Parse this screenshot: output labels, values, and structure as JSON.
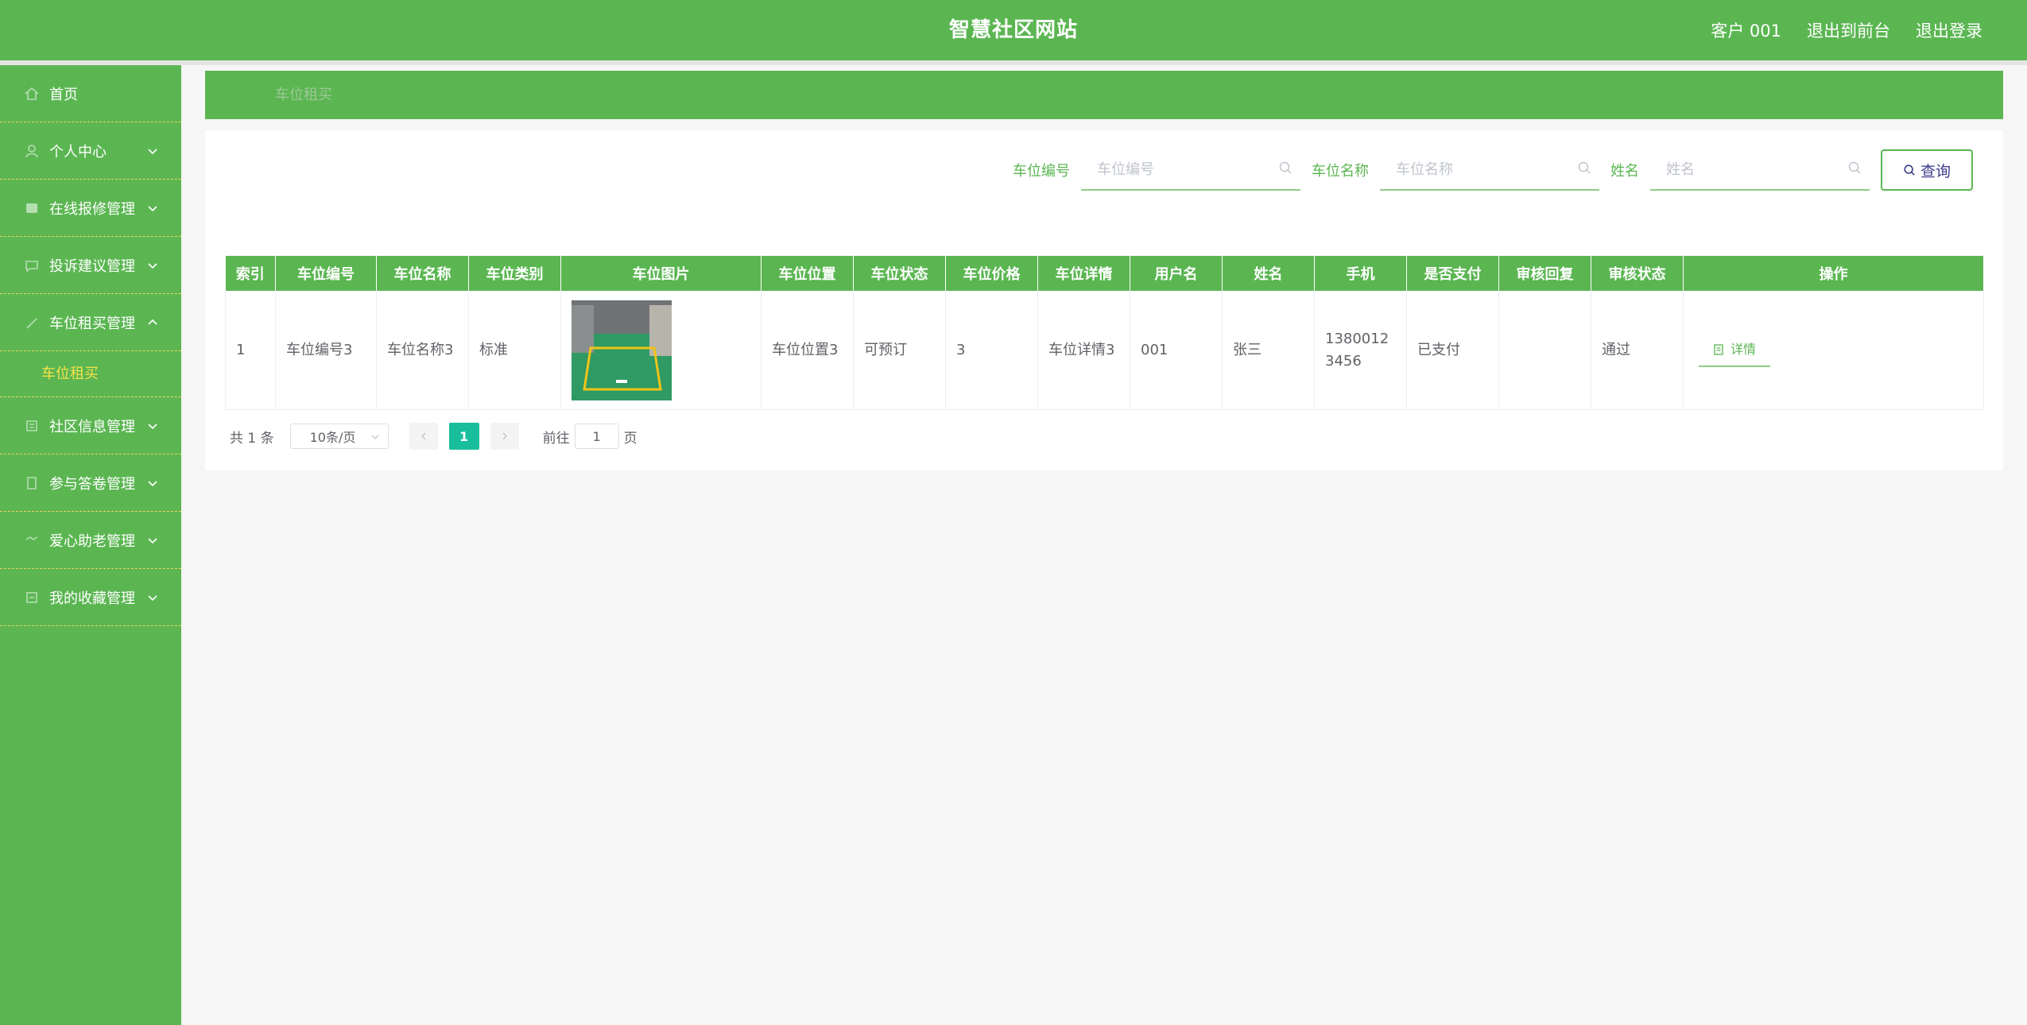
{
  "header": {
    "title": "智慧社区网站",
    "user": "客户 001",
    "to_front": "退出到前台",
    "logout": "退出登录"
  },
  "sidebar": {
    "items": [
      {
        "label": "首页",
        "icon": "home-icon",
        "has_children": false
      },
      {
        "label": "个人中心",
        "icon": "user-icon",
        "has_children": true
      },
      {
        "label": "在线报修管理",
        "icon": "repair-icon",
        "has_children": true
      },
      {
        "label": "投诉建议管理",
        "icon": "complaint-icon",
        "has_children": true
      },
      {
        "label": "车位租买管理",
        "icon": "parking-icon",
        "has_children": true,
        "expanded": true
      },
      {
        "label": "社区信息管理",
        "icon": "info-icon",
        "has_children": true
      },
      {
        "label": "参与答卷管理",
        "icon": "survey-icon",
        "has_children": true
      },
      {
        "label": "爱心助老管理",
        "icon": "heart-icon",
        "has_children": true
      },
      {
        "label": "我的收藏管理",
        "icon": "favorite-icon",
        "has_children": true
      }
    ],
    "active_sub": "车位租买"
  },
  "breadcrumb": "车位租买",
  "search": {
    "fields": [
      {
        "label": "车位编号",
        "placeholder": "车位编号"
      },
      {
        "label": "车位名称",
        "placeholder": "车位名称"
      },
      {
        "label": "姓名",
        "placeholder": "姓名"
      }
    ],
    "query_label": "查询"
  },
  "table": {
    "columns": [
      "索引",
      "车位编号",
      "车位名称",
      "车位类别",
      "车位图片",
      "车位位置",
      "车位状态",
      "车位价格",
      "车位详情",
      "用户名",
      "姓名",
      "手机",
      "是否支付",
      "审核回复",
      "审核状态",
      "操作"
    ],
    "rows": [
      {
        "index": "1",
        "code": "车位编号3",
        "name": "车位名称3",
        "category": "标准",
        "location": "车位位置3",
        "status": "可预订",
        "price": "3",
        "detail": "车位详情3",
        "username": "001",
        "realname": "张三",
        "phone": "13800123456",
        "paid": "已支付",
        "review_reply": "",
        "review_status": "通过",
        "action_label": "详情"
      }
    ]
  },
  "pager": {
    "total": "共 1 条",
    "page_size": "10条/页",
    "current": "1",
    "goto_prefix": "前往",
    "goto_value": "1",
    "goto_suffix": "页"
  },
  "colors": {
    "primary_green": "#5bb652",
    "submenu_active": "#f5e14a",
    "pager_active": "#19be9c"
  }
}
